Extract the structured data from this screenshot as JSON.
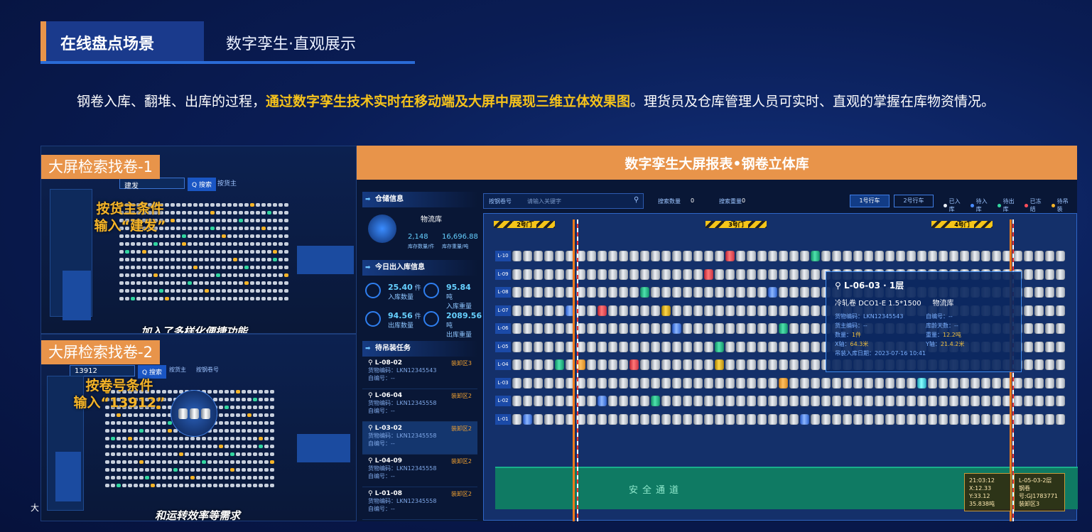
{
  "header": {
    "tab": "在线盘点场景",
    "subtitle": "数字孪生·直观展示"
  },
  "intro": {
    "before": "钢卷入库、翻堆、出库的过程，",
    "highlight": "通过数字孪生技术实时在移动端及大屏中展现三维立体效果图",
    "after": "。理货员及仓库管理人员可实时、直观的掌握在库物资情况。"
  },
  "panel1": {
    "label": "大屏检索找卷-1",
    "search_value": "建发",
    "search_btn": "Q 搜索",
    "option": "按货主",
    "tip_line1": "按货主条件",
    "tip_line2": "输入“建发”",
    "caption": "加入了多样化便捷功能"
  },
  "panel2": {
    "label": "大屏检索找卷-2",
    "search_value": "13912",
    "search_btn": "Q 搜索",
    "option1": "按货主",
    "option2": "按钢卷号",
    "tip_line1": "按卷号条件",
    "tip_line2": "输入“13912”",
    "caption": "和运转效率等需求"
  },
  "footer_char": "大",
  "bigscreen": {
    "title": "数字孪生大屏报表•钢卷立体库",
    "storage_title": "仓储信息",
    "warehouse_name": "物流库",
    "stock_count": "2,148",
    "stock_count_label": "库存数量/件",
    "stock_weight": "16,696.88",
    "stock_weight_label": "库存重量/吨",
    "today_title": "今日出入库信息",
    "in_count": "25.40",
    "in_count_unit": "件",
    "in_count_label": "入库数量",
    "in_weight": "95.84",
    "in_weight_unit": "吨",
    "in_weight_label": "入库重量",
    "out_count": "94.56",
    "out_count_unit": "件",
    "out_count_label": "出库数量",
    "out_weight": "2089.56",
    "out_weight_unit": "吨",
    "out_weight_label": "出库重量",
    "task_title": "待吊装任务",
    "tasks": [
      {
        "loc": "L-08-02",
        "zone": "装卸区3",
        "code": "货物编码：LKN12345543",
        "self": "自编号：--"
      },
      {
        "loc": "L-06-04",
        "zone": "装卸区2",
        "code": "货物编码：LKN12345558",
        "self": "自编号：--"
      },
      {
        "loc": "L-03-02",
        "zone": "装卸区2",
        "code": "货物编码：LKN12345558",
        "self": "自编号：--"
      },
      {
        "loc": "L-04-09",
        "zone": "装卸区2",
        "code": "货物编码：LKN12345558",
        "self": "自编号：--"
      },
      {
        "loc": "L-01-08",
        "zone": "装卸区2",
        "code": "货物编码：LKN12345558",
        "self": "自编号：--"
      }
    ],
    "topbar": {
      "select": "按钢卷号",
      "placeholder": "请输入关键字",
      "search_count_label": "搜索数量",
      "search_count": "0",
      "search_weight_label": "搜索重量",
      "search_weight": "0",
      "crane1": "1号行车",
      "crane2": "2号行车"
    },
    "legend": [
      {
        "label": "已入库",
        "color": "#e9eef6"
      },
      {
        "label": "待入库",
        "color": "#4a8cff"
      },
      {
        "label": "待出库",
        "color": "#32d6a0"
      },
      {
        "label": "已冻结",
        "color": "#ff4d5a"
      },
      {
        "label": "待吊装",
        "color": "#f5b428"
      }
    ],
    "gates": [
      "2号门",
      "3号门",
      "4号门"
    ],
    "rows": [
      "L-10",
      "L-09",
      "L-08",
      "L-07",
      "L-06",
      "L-05",
      "L-04",
      "L-03",
      "L-02",
      "L-01"
    ],
    "safe_text": "安全通道",
    "popup": {
      "title": "L-06-03 · 1层",
      "name": "冷轧卷 DCO1-E 1.5*1500",
      "warehouse": "物流库",
      "code": "货物编码：LKN12345543",
      "self": "自编号：--",
      "owner": "货主编码：--",
      "days": "库龄天数：--",
      "qty_label": "数量：",
      "qty": "1件",
      "weight_label": "重量：",
      "weight": "12.2吨",
      "x_label": "X轴：",
      "x": "64.3米",
      "y_label": "Y轴：",
      "y": "21.4.2米",
      "date": "吊装入库日期：2023-07-16  10:41"
    },
    "box1": {
      "l1": "21:03:12",
      "l2": "X:12.33 Y:33.12",
      "l3": "35.838吨"
    },
    "box2": {
      "l1": "L-05-03-2层",
      "l2": "钢卷号:GJ1783771",
      "l3": "装卸区3"
    }
  }
}
